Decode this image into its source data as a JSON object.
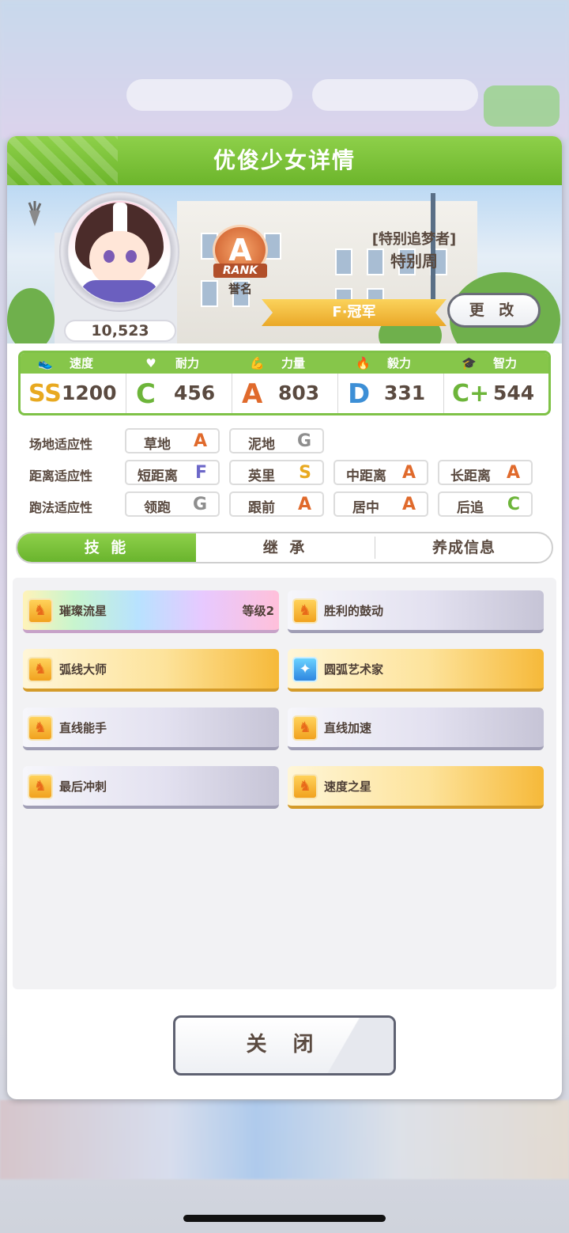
{
  "dialog": {
    "title": "优俊少女详情"
  },
  "profile": {
    "fan_count": "10,523",
    "rank_letter": "A",
    "rank_tag": "RANK",
    "rank_sub": "誉名",
    "epithet": "[特别追梦者]",
    "name": "特别周",
    "title_ribbon": "F·冠军",
    "change_button": "更 改"
  },
  "stats": [
    {
      "label": "速度",
      "icon": "shoe-icon",
      "grade": "SS",
      "value": "1200"
    },
    {
      "label": "耐力",
      "icon": "heart-icon",
      "grade": "C",
      "value": "456"
    },
    {
      "label": "力量",
      "icon": "muscle-icon",
      "grade": "A",
      "value": "803"
    },
    {
      "label": "毅力",
      "icon": "flame-icon",
      "grade": "D",
      "value": "331"
    },
    {
      "label": "智力",
      "icon": "graduation-cap-icon",
      "grade": "C+",
      "value": "544"
    }
  ],
  "aptitude": {
    "track": {
      "label": "场地适应性",
      "items": [
        {
          "name": "草地",
          "grade": "A"
        },
        {
          "name": "泥地",
          "grade": "G"
        }
      ]
    },
    "distance": {
      "label": "距离适应性",
      "items": [
        {
          "name": "短距离",
          "grade": "F"
        },
        {
          "name": "英里",
          "grade": "S"
        },
        {
          "name": "中距离",
          "grade": "A"
        },
        {
          "name": "长距离",
          "grade": "A"
        }
      ]
    },
    "style": {
      "label": "跑法适应性",
      "items": [
        {
          "name": "领跑",
          "grade": "G"
        },
        {
          "name": "跟前",
          "grade": "A"
        },
        {
          "name": "居中",
          "grade": "A"
        },
        {
          "name": "后追",
          "grade": "C"
        }
      ]
    }
  },
  "tabs": [
    {
      "label": "技 能",
      "active": true
    },
    {
      "label": "继 承",
      "active": false
    },
    {
      "label": "养成信息",
      "active": false
    }
  ],
  "skills": [
    {
      "name": "璀璨流星",
      "level": "等级2",
      "tier": "rainbow",
      "icon": "speed-horse-icon"
    },
    {
      "name": "胜利的鼓动",
      "level": "",
      "tier": "silver",
      "icon": "speed-horse-icon"
    },
    {
      "name": "弧线大师",
      "level": "",
      "tier": "gold",
      "icon": "speed-horse-icon"
    },
    {
      "name": "圆弧艺术家",
      "level": "",
      "tier": "gold",
      "icon": "sparkle-blue-icon"
    },
    {
      "name": "直线能手",
      "level": "",
      "tier": "silver",
      "icon": "speed-horse-icon"
    },
    {
      "name": "直线加速",
      "level": "",
      "tier": "silver",
      "icon": "speed-horse-icon"
    },
    {
      "name": "最后冲刺",
      "level": "",
      "tier": "silver",
      "icon": "speed-horse-icon"
    },
    {
      "name": "速度之星",
      "level": "",
      "tier": "gold",
      "icon": "speed-horse-icon"
    }
  ],
  "close_button": "关 闭",
  "colors": {
    "header_green": "#6cb52b",
    "grade_A": "#e06a2c",
    "grade_C": "#6db53a",
    "grade_D": "#3d8fd6",
    "grade_S": "#e8a920",
    "grade_F": "#6c67c8",
    "grade_G": "#8e8e8e"
  }
}
